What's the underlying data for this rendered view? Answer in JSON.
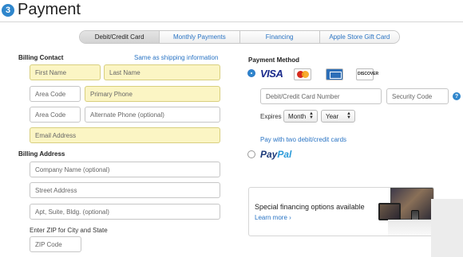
{
  "header": {
    "step": "3",
    "title": "Payment"
  },
  "tabs": [
    "Debit/Credit Card",
    "Monthly Payments",
    "Financing",
    "Apple Store Gift Card"
  ],
  "billing_contact": {
    "label": "Billing Contact",
    "shipping_link": "Same as shipping information",
    "first_name_placeholder": "First Name",
    "last_name_placeholder": "Last Name",
    "area_code_placeholder": "Area Code",
    "primary_phone_placeholder": "Primary Phone",
    "alt_area_code_placeholder": "Area Code",
    "alt_phone_placeholder": "Alternate Phone (optional)",
    "email_placeholder": "Email Address"
  },
  "billing_address": {
    "label": "Billing Address",
    "company_placeholder": "Company Name (optional)",
    "street_placeholder": "Street Address",
    "apt_placeholder": "Apt, Suite, Bldg. (optional)",
    "zip_label": "Enter ZIP for City and State",
    "zip_placeholder": "ZIP Code"
  },
  "payment_method": {
    "label": "Payment Method",
    "visa": "VISA",
    "discover": "DISCOVER",
    "card_number_placeholder": "Debit/Credit Card Number",
    "security_code_placeholder": "Security Code",
    "help": "?",
    "expires_label": "Expires",
    "month": "Month",
    "year": "Year",
    "two_cards_link": "Pay with two debit/credit cards",
    "paypal_pay": "Pay",
    "paypal_pal": "Pal"
  },
  "promo": {
    "title": "Special financing options available",
    "link": "Learn more ›"
  },
  "colors": {
    "accent": "#2f86cc",
    "link": "#2a74c4",
    "highlight_field": "#fbf5c4"
  }
}
